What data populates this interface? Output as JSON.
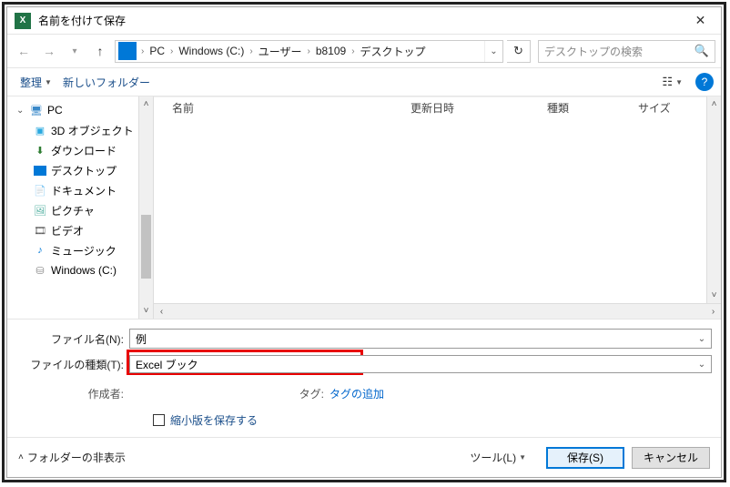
{
  "window": {
    "title": "名前を付けて保存"
  },
  "nav": {
    "path": {
      "seg0": "PC",
      "seg1": "Windows (C:)",
      "seg2": "ユーザー",
      "seg3": "b8109",
      "seg4": "デスクトップ"
    },
    "search_placeholder": "デスクトップの検索"
  },
  "toolbar": {
    "organize": "整理",
    "new_folder": "新しいフォルダー"
  },
  "sidebar": {
    "pc": "PC",
    "objects3d": "3D オブジェクト",
    "downloads": "ダウンロード",
    "desktop": "デスクトップ",
    "documents": "ドキュメント",
    "pictures": "ピクチャ",
    "videos": "ビデオ",
    "music": "ミュージック",
    "drive_c": "Windows (C:)"
  },
  "columns": {
    "name": "名前",
    "date": "更新日時",
    "type": "種類",
    "size": "サイズ"
  },
  "form": {
    "filename_label": "ファイル名(N):",
    "filename_value": "例",
    "filetype_label": "ファイルの種類(T):",
    "filetype_value": "Excel ブック",
    "author_label": "作成者:",
    "author_value": "",
    "tag_label": "タグ:",
    "tag_placeholder": "タグの追加",
    "save_thumbnail": "縮小版を保存する"
  },
  "footer": {
    "hide_folders": "フォルダーの非表示",
    "tools": "ツール(L)",
    "save": "保存(S)",
    "cancel": "キャンセル"
  }
}
